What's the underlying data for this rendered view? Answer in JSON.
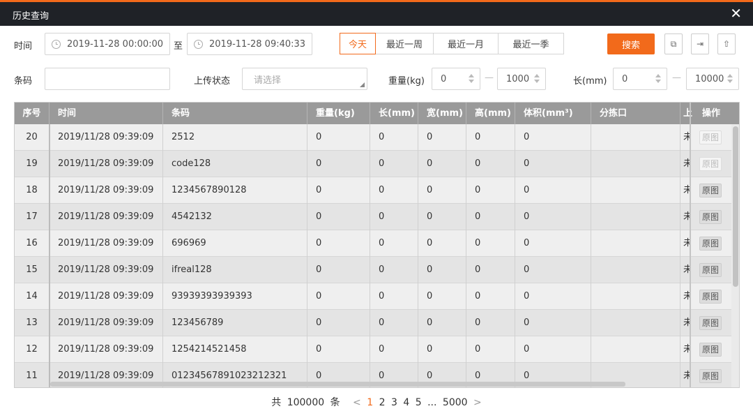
{
  "window": {
    "title": "历史查询",
    "close": "✕"
  },
  "filters": {
    "time_label": "时间",
    "time_from": "2019-11-28 00:00:00",
    "time_to_sep": "至",
    "time_to": "2019-11-28 09:40:33",
    "ranges": [
      "今天",
      "最近一周",
      "最近一月",
      "最近一季"
    ],
    "active_range": "今天",
    "search": "搜索",
    "barcode_label": "条码",
    "barcode_value": "",
    "upload_label": "上传状态",
    "upload_placeholder": "请选择",
    "weight_label": "重量(kg)",
    "weight_min": "0",
    "weight_max": "1000",
    "length_label": "长(mm)",
    "length_min": "0",
    "length_max": "10000",
    "dash": "—"
  },
  "toolbar_icons": [
    "restore-icon",
    "export-icon",
    "upload-icon"
  ],
  "table": {
    "headers": {
      "seq": "序号",
      "time": "时间",
      "barcode": "条码",
      "weight": "重量(kg)",
      "length": "长(mm)",
      "width": "宽(mm)",
      "height": "高(mm)",
      "volume": "体积(mm³)",
      "port": "分拣口",
      "upload": "上",
      "action": "操作"
    },
    "rows": [
      {
        "seq": "20",
        "time": "2019/11/28 09:39:09",
        "barcode": "2512",
        "weight": "0",
        "length": "0",
        "width": "0",
        "height": "0",
        "volume": "0",
        "port": "",
        "upload": "未",
        "action": "原图",
        "enabled": false
      },
      {
        "seq": "19",
        "time": "2019/11/28 09:39:09",
        "barcode": "code128",
        "weight": "0",
        "length": "0",
        "width": "0",
        "height": "0",
        "volume": "0",
        "port": "",
        "upload": "未",
        "action": "原图",
        "enabled": false
      },
      {
        "seq": "18",
        "time": "2019/11/28 09:39:09",
        "barcode": "1234567890128",
        "weight": "0",
        "length": "0",
        "width": "0",
        "height": "0",
        "volume": "0",
        "port": "",
        "upload": "未",
        "action": "原图",
        "enabled": true
      },
      {
        "seq": "17",
        "time": "2019/11/28 09:39:09",
        "barcode": "4542132",
        "weight": "0",
        "length": "0",
        "width": "0",
        "height": "0",
        "volume": "0",
        "port": "",
        "upload": "未",
        "action": "原图",
        "enabled": true
      },
      {
        "seq": "16",
        "time": "2019/11/28 09:39:09",
        "barcode": "696969",
        "weight": "0",
        "length": "0",
        "width": "0",
        "height": "0",
        "volume": "0",
        "port": "",
        "upload": "未",
        "action": "原图",
        "enabled": true
      },
      {
        "seq": "15",
        "time": "2019/11/28 09:39:09",
        "barcode": "ifreal128",
        "weight": "0",
        "length": "0",
        "width": "0",
        "height": "0",
        "volume": "0",
        "port": "",
        "upload": "未",
        "action": "原图",
        "enabled": true
      },
      {
        "seq": "14",
        "time": "2019/11/28 09:39:09",
        "barcode": "93939393939393",
        "weight": "0",
        "length": "0",
        "width": "0",
        "height": "0",
        "volume": "0",
        "port": "",
        "upload": "未",
        "action": "原图",
        "enabled": true
      },
      {
        "seq": "13",
        "time": "2019/11/28 09:39:09",
        "barcode": "123456789",
        "weight": "0",
        "length": "0",
        "width": "0",
        "height": "0",
        "volume": "0",
        "port": "",
        "upload": "未",
        "action": "原图",
        "enabled": true
      },
      {
        "seq": "12",
        "time": "2019/11/28 09:39:09",
        "barcode": "1254214521458",
        "weight": "0",
        "length": "0",
        "width": "0",
        "height": "0",
        "volume": "0",
        "port": "",
        "upload": "未",
        "action": "原图",
        "enabled": true
      },
      {
        "seq": "11",
        "time": "2019/11/28 09:39:09",
        "barcode": "01234567891023212321",
        "weight": "0",
        "length": "0",
        "width": "0",
        "height": "0",
        "volume": "0",
        "port": "",
        "upload": "未",
        "action": "原图",
        "enabled": true
      }
    ]
  },
  "pagination": {
    "total_prefix": "共",
    "total": "100000",
    "total_suffix": "条",
    "prev": "<",
    "pages": [
      "1",
      "2",
      "3",
      "4",
      "5"
    ],
    "active_page": "1",
    "ellipsis": "...",
    "last_page": "5000",
    "next": ">"
  },
  "colors": {
    "accent": "#f26a1b",
    "titlebar": "#1f2227",
    "header": "#9a9a9a"
  }
}
